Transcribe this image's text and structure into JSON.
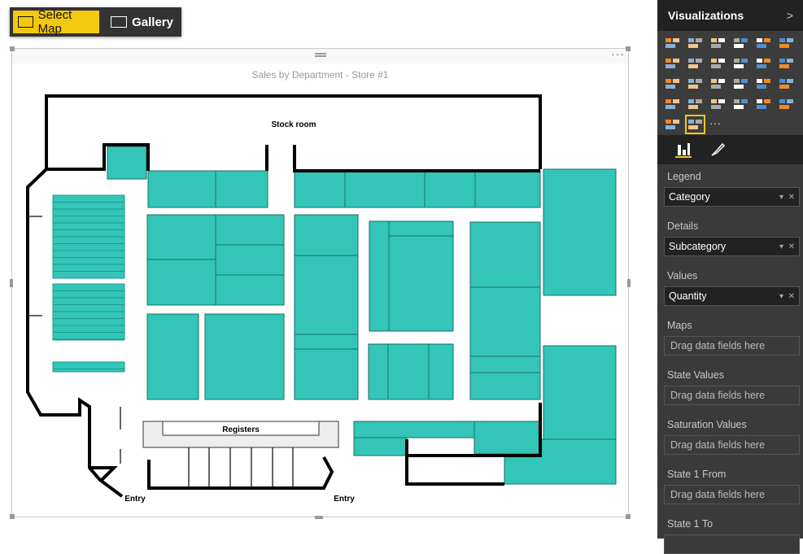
{
  "toolbar": {
    "select_map": "Select Map",
    "gallery": "Gallery"
  },
  "visual": {
    "title": "Sales by Department - Store #1",
    "more": "···",
    "labels": {
      "stock_room": "Stock room",
      "registers": "Registers",
      "entry_left": "Entry",
      "entry_right": "Entry"
    },
    "fill_color": "#33c5b8"
  },
  "pane": {
    "title": "Visualizations",
    "expand": ">",
    "icons": [
      "stacked-bar-chart",
      "stacked-column-chart",
      "clustered-bar-chart",
      "clustered-column-chart",
      "100-stacked-bar-chart",
      "100-stacked-column-chart",
      "line-chart",
      "area-chart",
      "line-and-stacked-column-chart",
      "line-and-clustered-column-chart",
      "ribbon-chart",
      "scatter-chart",
      "pie-chart",
      "treemap",
      "map",
      "table",
      "matrix",
      "filled-map",
      "funnel",
      "gauge",
      "multi-row-card",
      "card",
      "slicer",
      "donut-chart",
      "custom-visual",
      "synoptic-panel",
      "more-visuals"
    ],
    "selected_icon": "synoptic-panel",
    "tabs": [
      "fields",
      "format"
    ],
    "wells": [
      {
        "label": "Legend",
        "value": "Category"
      },
      {
        "label": "Details",
        "value": "Subcategory"
      },
      {
        "label": "Values",
        "value": "Quantity"
      },
      {
        "label": "Maps",
        "placeholder": "Drag data fields here"
      },
      {
        "label": "State Values",
        "placeholder": "Drag data fields here"
      },
      {
        "label": "Saturation Values",
        "placeholder": "Drag data fields here"
      },
      {
        "label": "State 1 From",
        "placeholder": "Drag data fields here"
      },
      {
        "label": "State 1 To"
      }
    ]
  }
}
